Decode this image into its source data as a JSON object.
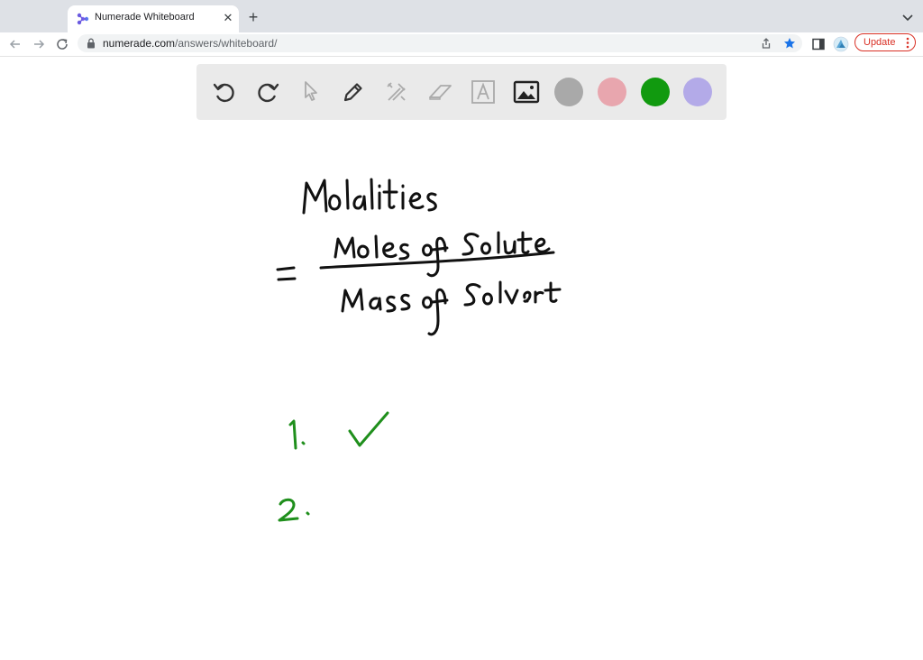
{
  "browser": {
    "tab_title": "Numerade Whiteboard",
    "tab_close_glyph": "✕",
    "new_tab_glyph": "+",
    "url_host": "numerade.com",
    "url_path": "/answers/whiteboard/",
    "update_label": "Update"
  },
  "whiteboard": {
    "tools": [
      "undo-icon",
      "redo-icon",
      "pointer-icon",
      "pencil-icon",
      "tools-icon",
      "eraser-icon",
      "text-icon",
      "image-icon"
    ],
    "colors": {
      "gray": "#a9a9a9",
      "pink": "#e8a6ae",
      "green": "#119a0f",
      "lavender": "#b3aae8"
    },
    "ink_black": "#111111",
    "ink_green": "#1f8f1c"
  }
}
